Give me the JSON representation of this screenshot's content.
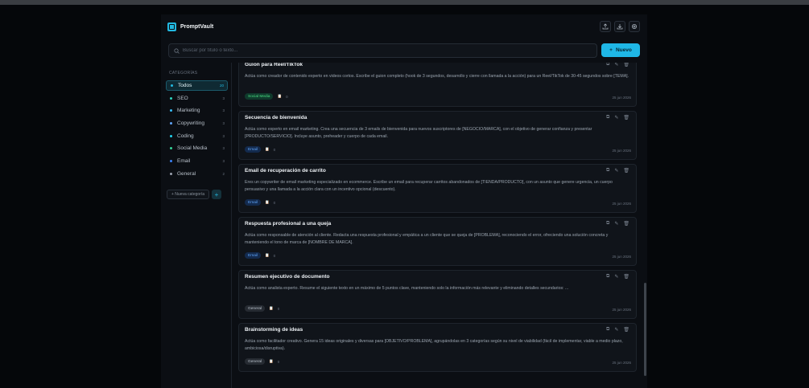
{
  "app": {
    "title": "PromptVault",
    "header_buttons": [
      "upload-icon",
      "download-icon",
      "gear-icon"
    ]
  },
  "search": {
    "placeholder": "Buscar por título o texto...",
    "value": ""
  },
  "new_button": {
    "icon": "+",
    "label": "Nuevo"
  },
  "sidebar": {
    "heading": "CATEGORÍAS",
    "items": [
      {
        "label": "Todos",
        "count": "20",
        "color": "#22b8e0",
        "active": true
      },
      {
        "label": "SEO",
        "count": "3",
        "color": "#2dd4bf"
      },
      {
        "label": "Marketing",
        "count": "3",
        "color": "#38bdf8"
      },
      {
        "label": "Copywriting",
        "count": "3",
        "color": "#60a5fa"
      },
      {
        "label": "Coding",
        "count": "3",
        "color": "#22d3ee"
      },
      {
        "label": "Social Media",
        "count": "3",
        "color": "#34d399"
      },
      {
        "label": "Email",
        "count": "3",
        "color": "#3b82f6"
      },
      {
        "label": "General",
        "count": "2",
        "color": "#9ca3af"
      }
    ],
    "new_category_label": "+ Nueva categoría",
    "add_icon": "+"
  },
  "prompts": [
    {
      "title": "Guion para Reel/TikTok",
      "text": "Actúa como creador de contenido experto en videos cortos. Escribe el guion completo (hook de 3 segundos, desarrollo y cierre con llamada a la acción) para un Reel/TikTok de 30-45 segundos sobre [TEMA].",
      "tag": "Social Media",
      "tag_bg": "#0f3a2c",
      "tag_fg": "#4ade80",
      "copies": "0",
      "date": "25 jun 2026"
    },
    {
      "title": "Secuencia de bienvenida",
      "text": "Actúa como experto en email marketing. Crea una secuencia de 3 emails de bienvenida para nuevos suscriptores de [NEGOCIO/MARCA], con el objetivo de generar confianza y presentar [PRODUCTO/SERVICIO]. Incluye asunto, preheader y cuerpo de cada email.",
      "tag": "Email",
      "tag_bg": "#132a4d",
      "tag_fg": "#60a5fa",
      "copies": "0",
      "date": "25 jun 2026"
    },
    {
      "title": "Email de recuperación de carrito",
      "text": "Eres un copywriter de email marketing especializado en ecommerce. Escribe un email para recuperar carritos abandonados de [TIENDA/PRODUCTO], con un asunto que genere urgencia, un cuerpo persuasivo y una llamada a la acción clara con un incentivo opcional (descuento).",
      "tag": "Email",
      "tag_bg": "#132a4d",
      "tag_fg": "#60a5fa",
      "copies": "0",
      "date": "25 jun 2026"
    },
    {
      "title": "Respuesta profesional a una queja",
      "text": "Actúa como responsable de atención al cliente. Redacta una respuesta profesional y empática a un cliente que se queja de [PROBLEMA], reconociendo el error, ofreciendo una solución concreta y manteniendo el tono de marca de [NOMBRE DE MARCA].",
      "tag": "Email",
      "tag_bg": "#132a4d",
      "tag_fg": "#60a5fa",
      "copies": "0",
      "date": "25 jun 2026"
    },
    {
      "title": "Resumen ejecutivo de documento",
      "text": "Actúa como analista experto. Resume el siguiente texto en un máximo de 5 puntos clave, manteniendo solo la información más relevante y eliminando detalles secundarios: ...",
      "tag": "General",
      "tag_bg": "#262b32",
      "tag_fg": "#b8c0ca",
      "copies": "0",
      "date": "25 jun 2026"
    },
    {
      "title": "Brainstorming de ideas",
      "text": "Actúa como facilitador creativo. Genera 15 ideas originales y diversas para [OBJETIVO/PROBLEMA], agrupándolas en 3 categorías según su nivel de viabilidad (fácil de implementar, viable a medio plazo, ambiciosa/disruptiva).",
      "tag": "General",
      "tag_bg": "#262b32",
      "tag_fg": "#b8c0ca",
      "copies": "0",
      "date": "25 jun 2026"
    }
  ]
}
